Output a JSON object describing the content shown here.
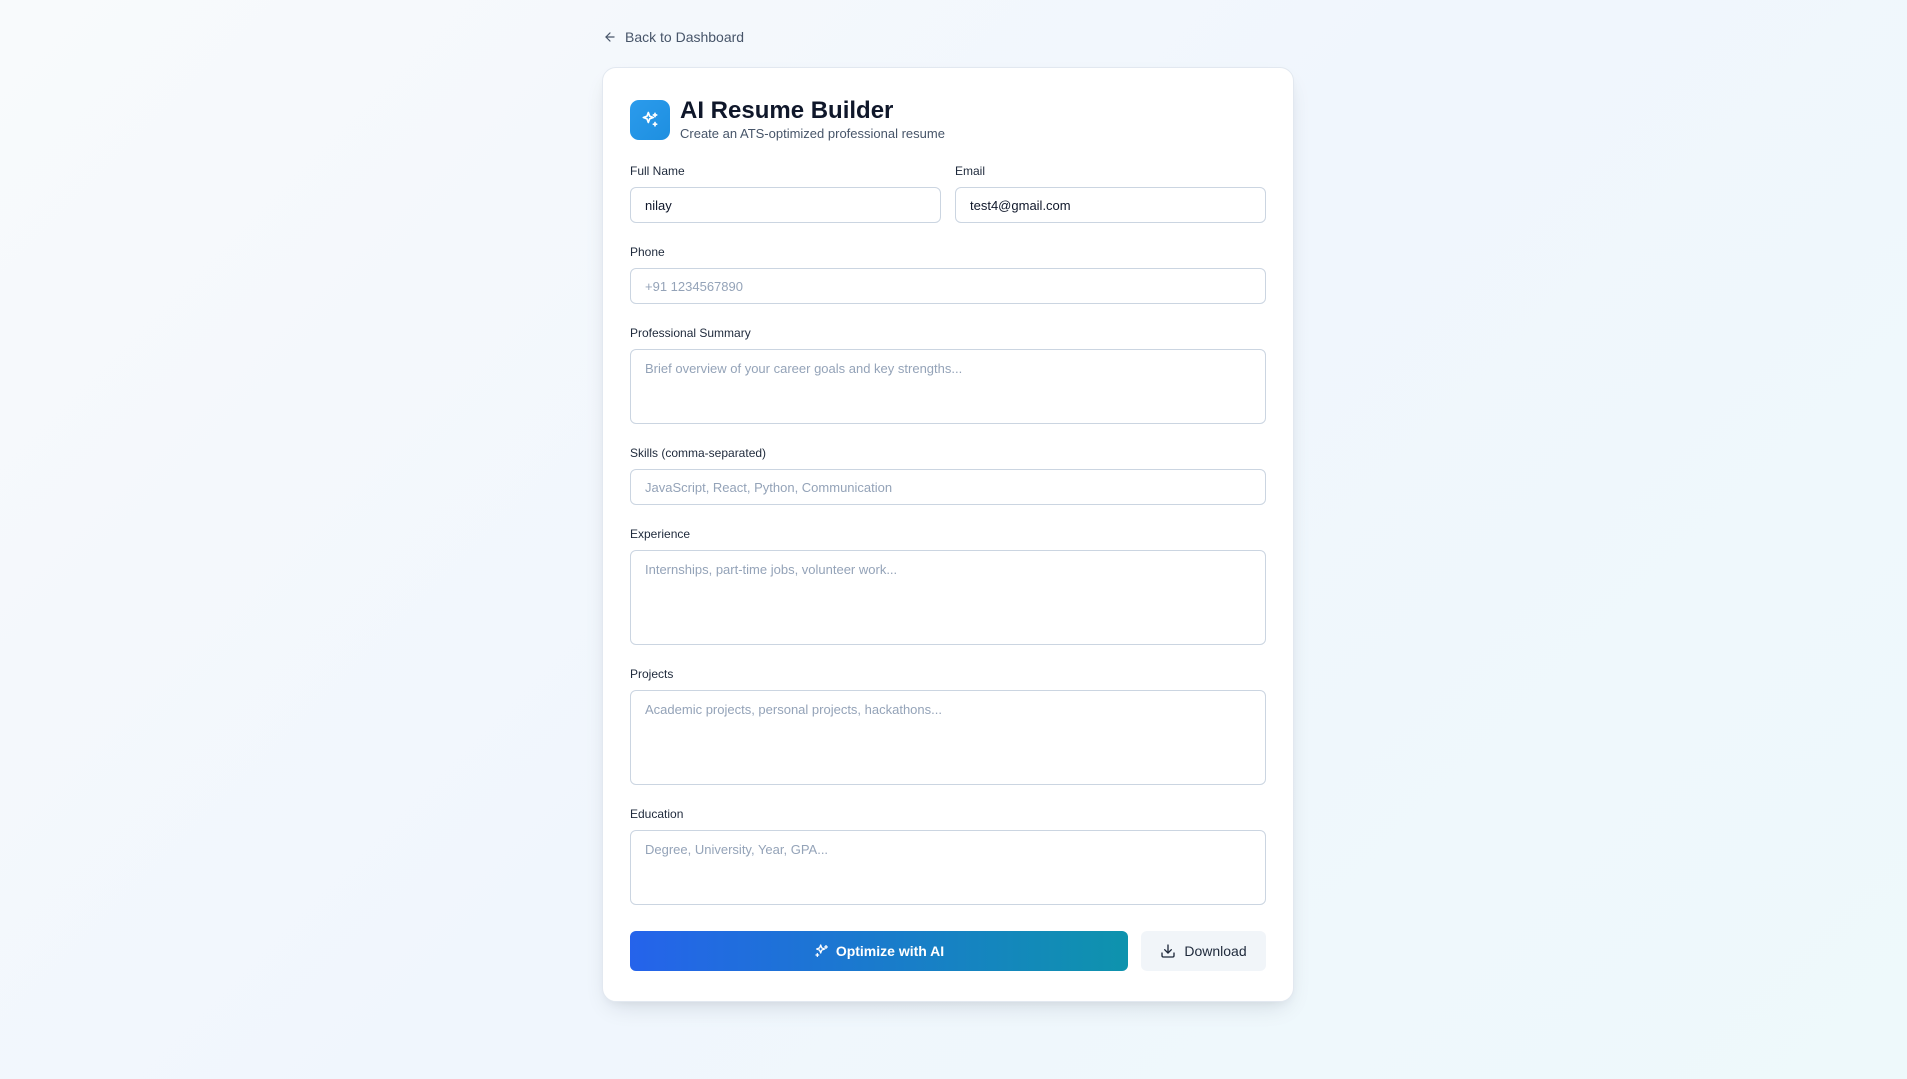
{
  "nav": {
    "back_label": "Back to Dashboard"
  },
  "header": {
    "title": "AI Resume Builder",
    "subtitle": "Create an ATS-optimized professional resume",
    "icon": "sparkles-icon"
  },
  "form": {
    "full_name": {
      "label": "Full Name",
      "value": "nilay",
      "placeholder": ""
    },
    "email": {
      "label": "Email",
      "value": "test4@gmail.com",
      "placeholder": ""
    },
    "phone": {
      "label": "Phone",
      "value": "",
      "placeholder": "+91 1234567890"
    },
    "summary": {
      "label": "Professional Summary",
      "value": "",
      "placeholder": "Brief overview of your career goals and key strengths..."
    },
    "skills": {
      "label": "Skills (comma-separated)",
      "value": "",
      "placeholder": "JavaScript, React, Python, Communication"
    },
    "experience": {
      "label": "Experience",
      "value": "",
      "placeholder": "Internships, part-time jobs, volunteer work..."
    },
    "projects": {
      "label": "Projects",
      "value": "",
      "placeholder": "Academic projects, personal projects, hackathons..."
    },
    "education": {
      "label": "Education",
      "value": "",
      "placeholder": "Degree, University, Year, GPA..."
    }
  },
  "actions": {
    "optimize_label": "Optimize with AI",
    "download_label": "Download"
  },
  "colors": {
    "logo_bg": "#2b9bec",
    "primary_gradient_start": "#2563eb",
    "primary_gradient_end": "#0e93ad",
    "secondary_bg": "#f1f5f9"
  }
}
